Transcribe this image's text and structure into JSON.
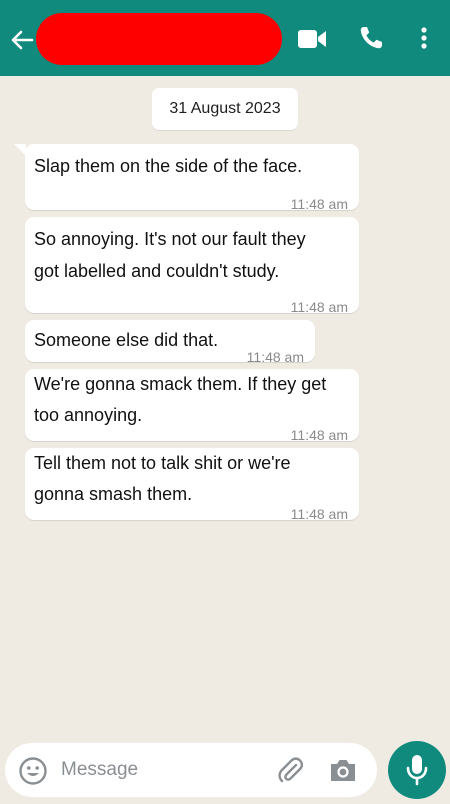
{
  "header": {
    "back_icon": "arrow-left-icon",
    "contact_name": "",
    "icons": [
      "video-camera-icon",
      "phone-icon",
      "more-vertical-icon"
    ],
    "colors": {
      "bar": "#0f8a7c",
      "redaction": "#ff0000"
    }
  },
  "chat": {
    "date_chip": "31 August 2023",
    "messages": [
      {
        "text": "Slap them on the side of the face.",
        "time": "11:48 am"
      },
      {
        "text": "So annoying. It's not our fault they\ngot labelled and couldn't study.",
        "time": "11:48 am"
      },
      {
        "text": "Someone else did that.",
        "time": "11:48 am"
      },
      {
        "text": "We're gonna smack them. If they get\ntoo annoying.",
        "time": "11:48 am"
      },
      {
        "text": "Tell them not to talk shit or we're\ngonna smash them.",
        "time": "11:48 am"
      }
    ],
    "colors": {
      "background": "#efeae2",
      "bubble": "#ffffff",
      "time": "#8a8a8a"
    }
  },
  "composer": {
    "placeholder": "Message",
    "value": "",
    "icons": [
      "emoji-icon",
      "paperclip-icon",
      "camera-icon",
      "microphone-icon"
    ],
    "colors": {
      "mic_button": "#0f8a7c"
    }
  }
}
